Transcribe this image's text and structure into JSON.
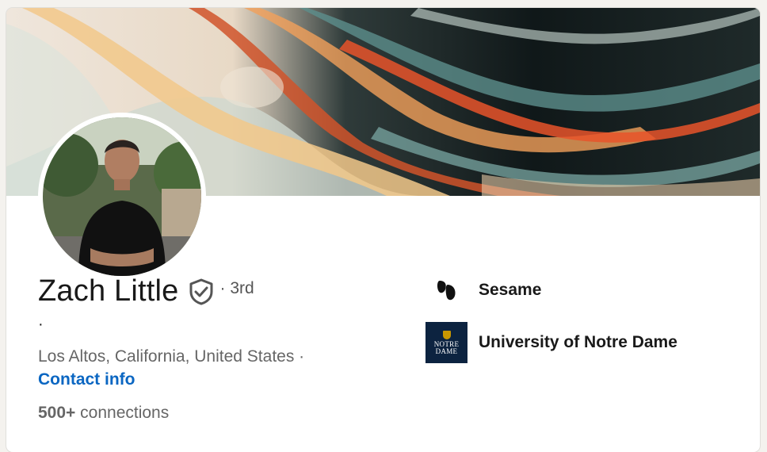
{
  "profile": {
    "name": "Zach Little",
    "degree": "· 3rd",
    "headline": "·",
    "location": "Los Altos, California, United States ·",
    "contact_label": "Contact info",
    "connections_count": "500+",
    "connections_label": "connections"
  },
  "organizations": [
    {
      "name": "Sesame",
      "logo": "sesame-logo"
    },
    {
      "name": "University of Notre Dame",
      "logo": "notre-dame-logo",
      "logo_text_1": "NOTRE",
      "logo_text_2": "DAME"
    }
  ],
  "icons": {
    "verified": "verified-shield-icon"
  },
  "colors": {
    "link": "#0a66c2",
    "text_primary": "#191919",
    "text_secondary": "#666666",
    "notre_dame_navy": "#0c2340"
  }
}
